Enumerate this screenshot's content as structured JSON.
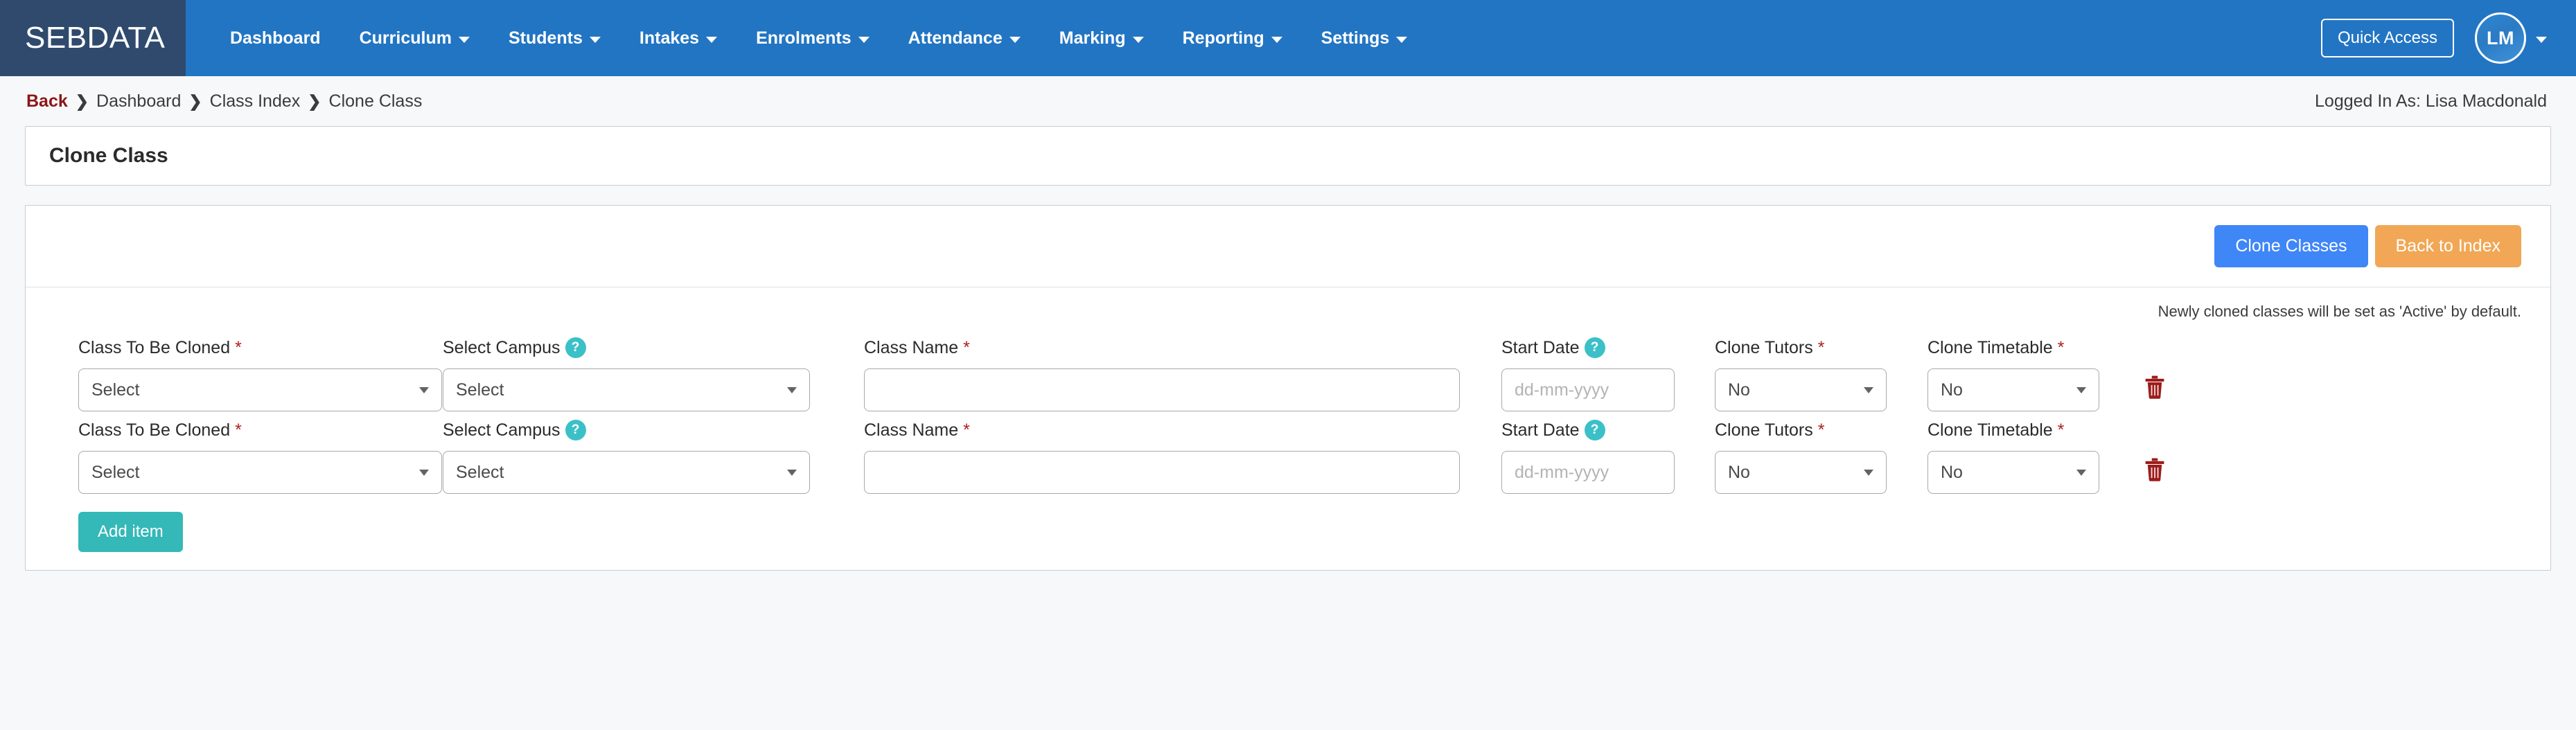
{
  "navbar": {
    "brand": "SEBDATA",
    "items": [
      {
        "label": "Dashboard",
        "has_caret": false
      },
      {
        "label": "Curriculum",
        "has_caret": true
      },
      {
        "label": "Students",
        "has_caret": true
      },
      {
        "label": "Intakes",
        "has_caret": true
      },
      {
        "label": "Enrolments",
        "has_caret": true
      },
      {
        "label": "Attendance",
        "has_caret": true
      },
      {
        "label": "Marking",
        "has_caret": true
      },
      {
        "label": "Reporting",
        "has_caret": true
      },
      {
        "label": "Settings",
        "has_caret": true
      }
    ],
    "quick_access_label": "Quick Access",
    "avatar_initials": "LM",
    "brand_bg": "#2f4a6d",
    "nav_bg": "#2275c3"
  },
  "breadcrumb": {
    "back_label": "Back",
    "separator": "❯",
    "items": [
      "Dashboard",
      "Class Index",
      "Clone Class"
    ],
    "logged_in_as": "Logged In As: Lisa Macdonald"
  },
  "page": {
    "title": "Clone Class"
  },
  "toolbar": {
    "clone_classes_label": "Clone Classes",
    "back_to_index_label": "Back to Index",
    "clone_color": "#3f86f7",
    "back_color": "#f1a755"
  },
  "note": {
    "text": "Newly cloned classes will be set as 'Active' by default."
  },
  "form": {
    "labels": {
      "class_to_be_cloned": "Class To Be Cloned",
      "select_campus": "Select Campus",
      "class_name": "Class Name",
      "start_date": "Start Date",
      "clone_tutors": "Clone Tutors",
      "clone_timetable": "Clone Timetable"
    },
    "required_marker": "*",
    "help_glyph": "?",
    "rows": [
      {
        "class_to_be_cloned": "Select",
        "select_campus": "Select",
        "class_name": "",
        "start_date": "",
        "start_date_placeholder": "dd-mm-yyyy",
        "clone_tutors": "No",
        "clone_timetable": "No"
      },
      {
        "class_to_be_cloned": "Select",
        "select_campus": "Select",
        "class_name": "",
        "start_date": "",
        "start_date_placeholder": "dd-mm-yyyy",
        "clone_tutors": "No",
        "clone_timetable": "No"
      }
    ],
    "add_item_label": "Add item",
    "add_item_color": "#34b8b8",
    "delete_icon_color": "#9e1b1b",
    "help_icon_color": "#3cc0c8"
  }
}
